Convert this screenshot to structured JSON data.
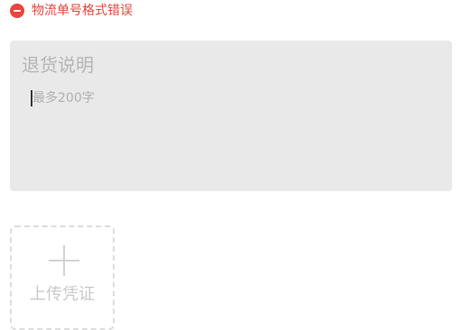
{
  "error": {
    "icon": "minus-circle-icon",
    "text": "物流单号格式错误",
    "color": "#e8453c"
  },
  "return_description": {
    "title": "退货说明",
    "placeholder": "最多200字",
    "background": "#e9e9e9"
  },
  "upload": {
    "icon": "plus-icon",
    "label": "上传凭证"
  }
}
